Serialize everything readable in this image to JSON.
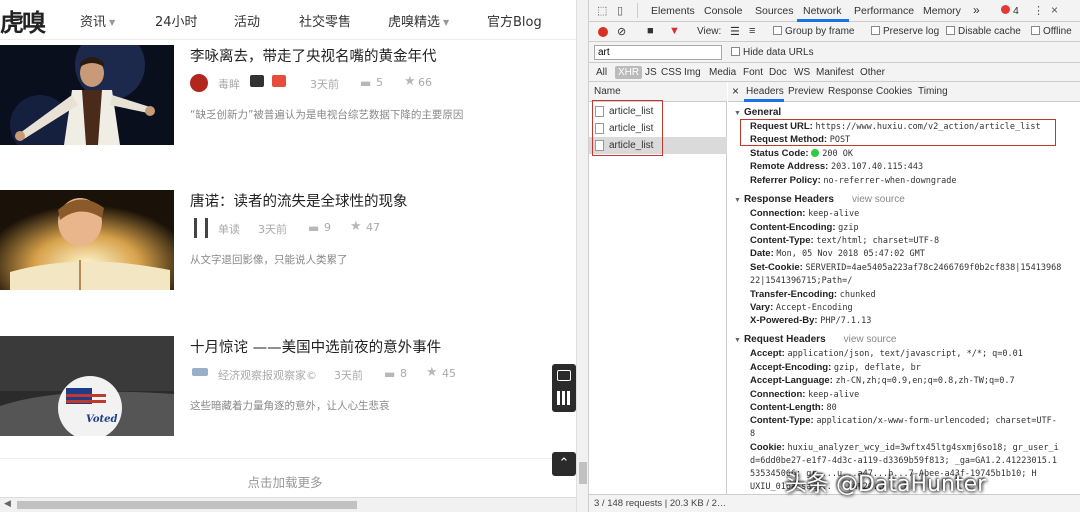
{
  "site": {
    "logo": "虎嗅",
    "nav": [
      {
        "label": "资讯",
        "caret": true
      },
      {
        "label": "24小时",
        "caret": false
      },
      {
        "label": "活动",
        "caret": false
      },
      {
        "label": "社交零售",
        "caret": false
      },
      {
        "label": "虎嗅精选",
        "caret": true
      },
      {
        "label": "官方Blog",
        "caret": false
      }
    ],
    "articles": [
      {
        "title": "李咏离去，带走了央视名嘴的黄金年代",
        "author": "毒眸",
        "time": "3天前",
        "comments": "5",
        "likes": "66",
        "desc": "“缺乏创新力”被普遍认为是电视台综艺数据下降的主要原因"
      },
      {
        "title": "唐诺：读者的流失是全球性的现象",
        "author": "单读",
        "time": "3天前",
        "comments": "9",
        "likes": "47",
        "desc": "从文字退回影像，只能说人类累了"
      },
      {
        "title": "十月惊诧 ——美国中选前夜的意外事件",
        "author": "经济观察报观察家©",
        "time": "3天前",
        "comments": "8",
        "likes": "45",
        "desc": "这些暗藏着力量角逐的意外，让人心生悲哀"
      }
    ],
    "load_more": "点击加载更多",
    "vote_sticker": "Voted"
  },
  "devtools": {
    "tabs": [
      "Elements",
      "Console",
      "Sources",
      "Network",
      "Performance",
      "Memory"
    ],
    "more": "»",
    "error_count": "4",
    "toolbar": {
      "view_label": "View:",
      "group_by_frame": "Group by frame",
      "preserve_log": "Preserve log",
      "disable_cache": "Disable cache",
      "offline": "Offline"
    },
    "filter": {
      "value": "art",
      "hide_data_urls": "Hide data URLs"
    },
    "types": [
      "All",
      "XHR",
      "JS",
      "CSS",
      "Img",
      "Media",
      "Font",
      "Doc",
      "WS",
      "Manifest",
      "Other"
    ],
    "name_header": "Name",
    "requests": [
      "article_list",
      "article_list",
      "article_list"
    ],
    "status_bar": "3 / 148 requests  |  20.3 KB / 2…",
    "detail_tabs": [
      "Headers",
      "Preview",
      "Response",
      "Cookies",
      "Timing"
    ],
    "close": "×",
    "general": {
      "title": "General",
      "rows": [
        {
          "k": "Request URL:",
          "v": "https://www.huxiu.com/v2_action/article_list"
        },
        {
          "k": "Request Method:",
          "v": "POST"
        },
        {
          "k": "Status Code:",
          "v": "200 OK"
        },
        {
          "k": "Remote Address:",
          "v": "203.107.40.115:443"
        },
        {
          "k": "Referrer Policy:",
          "v": "no-referrer-when-downgrade"
        }
      ]
    },
    "response_headers": {
      "title": "Response Headers",
      "view_source": "view source",
      "rows": [
        {
          "k": "Connection:",
          "v": "keep-alive"
        },
        {
          "k": "Content-Encoding:",
          "v": "gzip"
        },
        {
          "k": "Content-Type:",
          "v": "text/html; charset=UTF-8"
        },
        {
          "k": "Date:",
          "v": "Mon, 05 Nov 2018 05:47:02 GMT"
        },
        {
          "k": "Set-Cookie:",
          "v": "SERVERID=4ae5405a223af78c2466769f0b2cf838|15413968"
        },
        {
          "k": "",
          "v": "22|1541396715;Path=/"
        },
        {
          "k": "Transfer-Encoding:",
          "v": "chunked"
        },
        {
          "k": "Vary:",
          "v": "Accept-Encoding"
        },
        {
          "k": "X-Powered-By:",
          "v": "PHP/7.1.13"
        }
      ]
    },
    "request_headers": {
      "title": "Request Headers",
      "view_source": "view source",
      "rows": [
        {
          "k": "Accept:",
          "v": "application/json, text/javascript, */*; q=0.01"
        },
        {
          "k": "Accept-Encoding:",
          "v": "gzip, deflate, br"
        },
        {
          "k": "Accept-Language:",
          "v": "zh-CN,zh;q=0.9,en;q=0.8,zh-TW;q=0.7"
        },
        {
          "k": "Connection:",
          "v": "keep-alive"
        },
        {
          "k": "Content-Length:",
          "v": "80"
        },
        {
          "k": "Content-Type:",
          "v": "application/x-www-form-urlencoded; charset=UTF-"
        },
        {
          "k": "",
          "v": "8"
        },
        {
          "k": "Cookie:",
          "v": "huxiu_analyzer_wcy_id=3wftx45ltg4sxmj6so18; gr_user_i"
        },
        {
          "k": "",
          "v": "d=6dd0be27-e1f7-4d3c-a119-d3369b59f813; _ga=GA1.2.41223015.1"
        },
        {
          "k": "",
          "v": "535345066; gr_...u...a47...b...7-Abee-a43f-19745b1b10; H"
        },
        {
          "k": "",
          "v": "UXIU_016a_sai...              ...a%2C..."
        },
        {
          "k": "",
          "v": "22%3A768%2C%22d%22%3A1%7D; hm_lvt_2e0bc8c5e7ceb25796ba4962e7"
        },
        {
          "k": "",
          "v": "b57387=1537613902; is_test_hot_article=7; b6a739d69e7ea5b6 g"
        }
      ]
    }
  },
  "watermark": "头条 @DataHunter"
}
